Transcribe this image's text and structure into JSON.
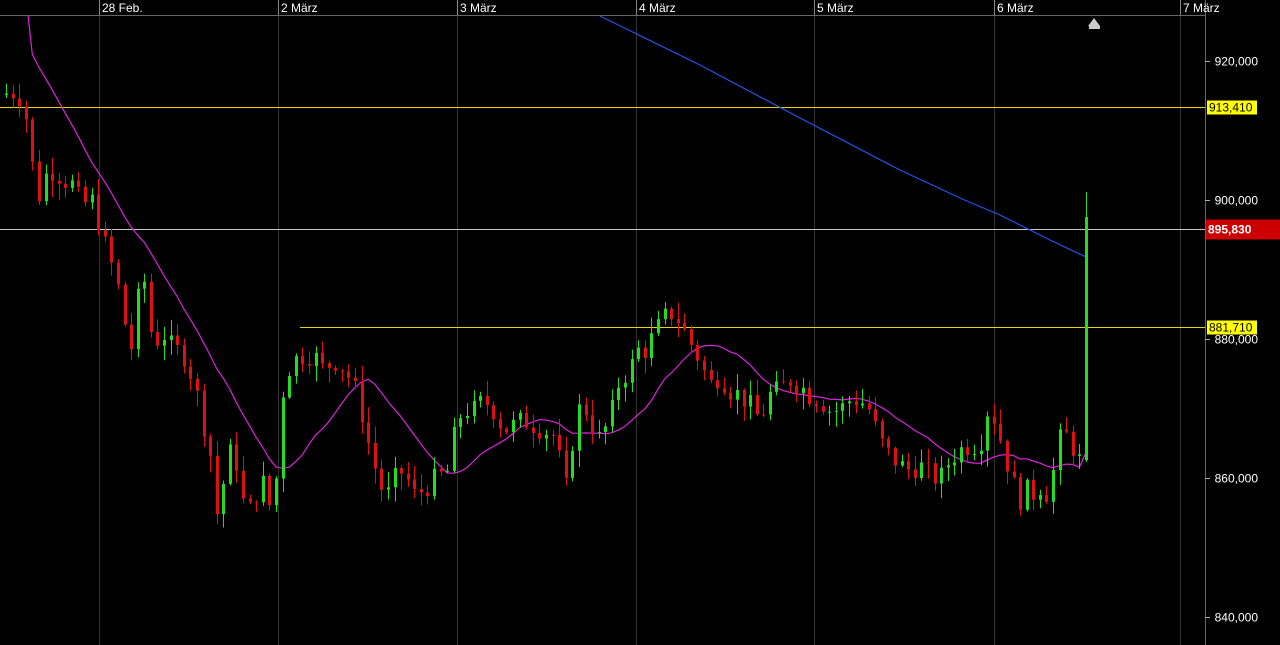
{
  "chart_data": {
    "type": "candlestick",
    "x_axis": {
      "labels": [
        "28 Feb.",
        "2 März",
        "3 März",
        "4 März",
        "5 März",
        "6 März",
        "7 März"
      ]
    },
    "y_axis": {
      "tick_labels": [
        "920,000",
        "900,000",
        "880,000",
        "860,000",
        "840,000"
      ],
      "tick_values": [
        920000,
        900000,
        880000,
        860000,
        840000
      ],
      "range": [
        836000,
        926500
      ]
    },
    "grid": true,
    "price_lines": [
      {
        "label": "913,410",
        "value": 913410,
        "kind": "level"
      },
      {
        "label": "895,830",
        "value": 895830,
        "kind": "current"
      },
      {
        "label": "881,710",
        "value": 881710,
        "kind": "level"
      }
    ],
    "series": [
      {
        "kind": "candles",
        "count": 165
      },
      {
        "kind": "moving-average"
      },
      {
        "kind": "moving-average"
      }
    ],
    "colors": {
      "background": "#000000",
      "up": "#22dd22",
      "down": "#dd1111",
      "level_line": "#e6d400",
      "level_box": "#ffff00",
      "current_box": "#cc0000",
      "ma_fast": "#dd22dd",
      "ma_slow": "#2255ee",
      "grid": "#333333",
      "axis_text": "#ffffff"
    },
    "icons": {
      "marker": "home-arrow-icon"
    }
  }
}
